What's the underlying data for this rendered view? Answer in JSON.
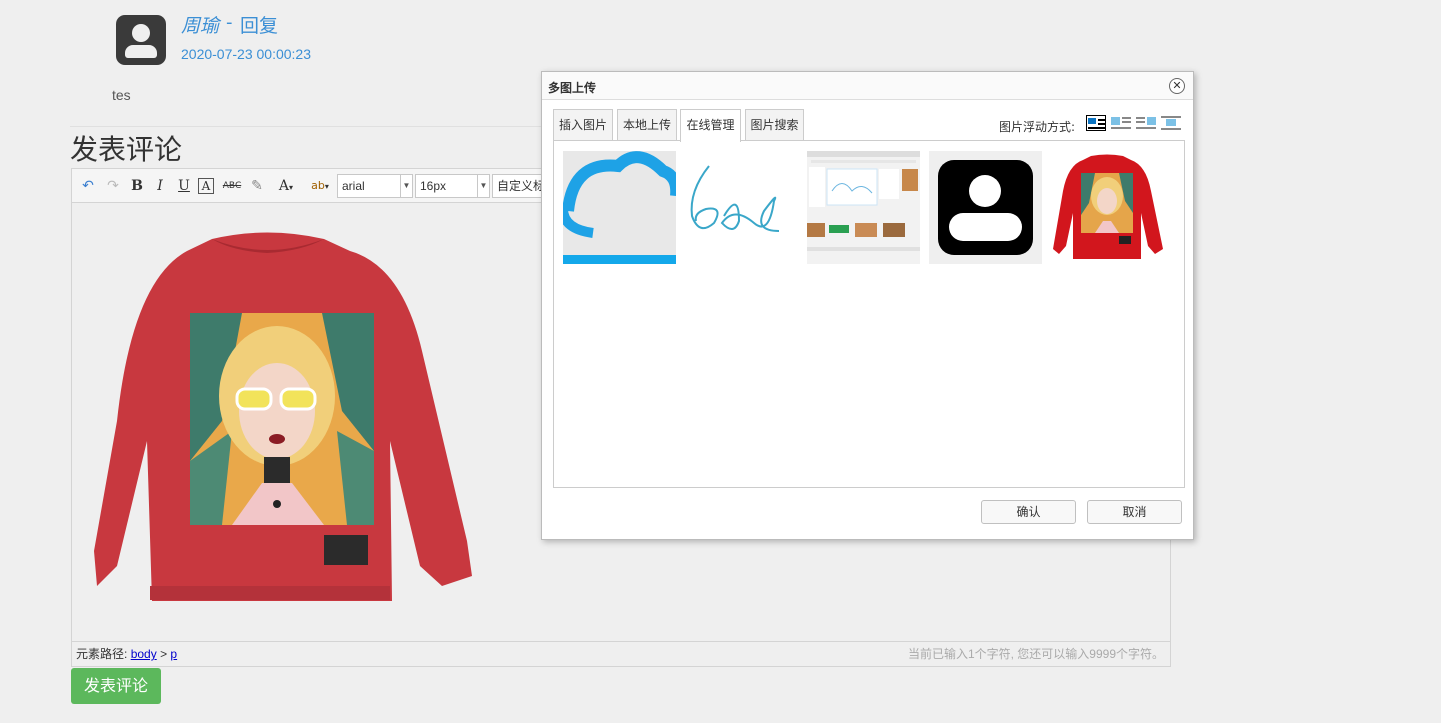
{
  "comment": {
    "author": "周瑜",
    "separator": "-",
    "reply_label": "回复",
    "timestamp": "2020-07-23 00:00:23",
    "text": "tes"
  },
  "section_title": "发表评论",
  "editor": {
    "toolbar": {
      "font_family": "arial",
      "font_size": "16px",
      "custom_title": "自定义标"
    },
    "status": {
      "path_label": "元素路径:",
      "path_body": "body",
      "path_sep": ">",
      "path_p": "p",
      "char_count": "当前已输入1个字符, 您还可以输入9999个字符。"
    }
  },
  "submit_label": "发表评论",
  "dialog": {
    "title": "多图上传",
    "close": "✕",
    "tabs": [
      "插入图片",
      "本地上传",
      "在线管理",
      "图片搜索"
    ],
    "active_tab": "在线管理",
    "float_label": "图片浮动方式:",
    "confirm_label": "确认",
    "cancel_label": "取消",
    "thumbnails": [
      "cloud-sketch-image",
      "handwriting-image",
      "webpage-screenshot-image",
      "avatar-placeholder-image",
      "sweater-image"
    ]
  },
  "colors": {
    "link": "#3b8fd5",
    "submit": "#5cb85c",
    "sweater": "#c8383f"
  }
}
